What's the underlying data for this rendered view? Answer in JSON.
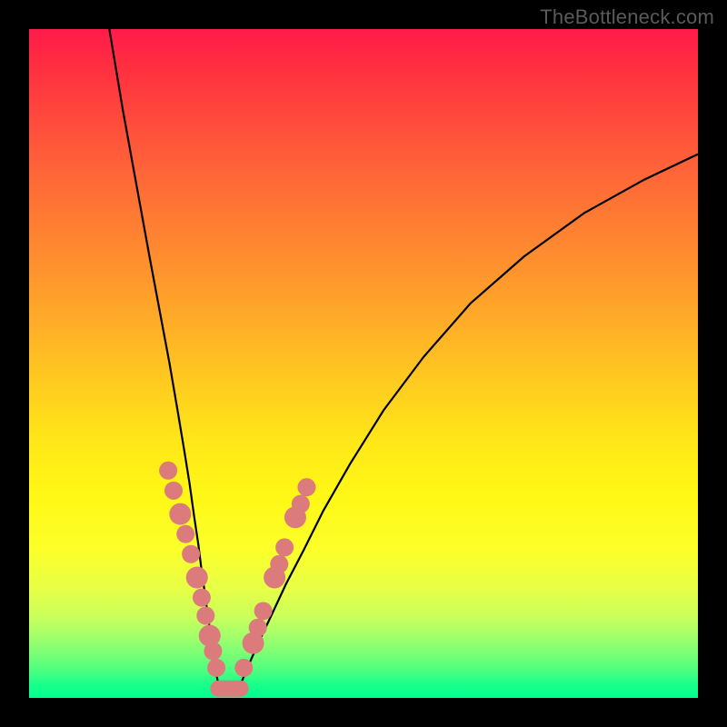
{
  "watermark": "TheBottleneck.com",
  "chart_data": {
    "type": "line",
    "title": "",
    "xlabel": "",
    "ylabel": "",
    "xlim": [
      0,
      100
    ],
    "ylim": [
      0,
      100
    ],
    "series": [
      {
        "name": "left-curve",
        "x": [
          12,
          14,
          16,
          18,
          19.5,
          21,
          22.2,
          23.2,
          24,
          24.7,
          25.3,
          25.8,
          26.3,
          26.7,
          27.1,
          27.4,
          27.7,
          28,
          28.3
        ],
        "values": [
          100,
          88,
          77,
          66,
          58,
          50,
          43,
          37,
          32,
          27,
          23,
          19,
          15.5,
          12.5,
          9.8,
          7.5,
          5.5,
          3.6,
          2
        ]
      },
      {
        "name": "right-curve",
        "x": [
          31.6,
          33,
          34.5,
          36.3,
          38.4,
          41,
          44,
          48,
          53,
          59,
          66,
          74,
          83,
          92,
          100
        ],
        "values": [
          2,
          5.3,
          8.7,
          12.5,
          17,
          22,
          28,
          35,
          43,
          51,
          59,
          66,
          72.5,
          77.5,
          81.3
        ]
      }
    ],
    "markers": {
      "left": [
        {
          "x": 20.8,
          "y": 34,
          "r": 10
        },
        {
          "x": 21.6,
          "y": 31,
          "r": 10
        },
        {
          "x": 22.6,
          "y": 27.5,
          "r": 12
        },
        {
          "x": 23.4,
          "y": 24.5,
          "r": 10
        },
        {
          "x": 24.2,
          "y": 21.5,
          "r": 10
        },
        {
          "x": 25.1,
          "y": 18,
          "r": 12
        },
        {
          "x": 25.8,
          "y": 15,
          "r": 10
        },
        {
          "x": 26.4,
          "y": 12.3,
          "r": 10
        },
        {
          "x": 27.0,
          "y": 9.3,
          "r": 12
        },
        {
          "x": 27.5,
          "y": 7,
          "r": 10
        },
        {
          "x": 28.0,
          "y": 4.5,
          "r": 10
        }
      ],
      "right": [
        {
          "x": 32.1,
          "y": 4.5,
          "r": 10
        },
        {
          "x": 33.5,
          "y": 8.2,
          "r": 12
        },
        {
          "x": 34.2,
          "y": 10.5,
          "r": 10
        },
        {
          "x": 35.0,
          "y": 13,
          "r": 10
        },
        {
          "x": 36.7,
          "y": 18,
          "r": 12
        },
        {
          "x": 37.4,
          "y": 20,
          "r": 10
        },
        {
          "x": 38.2,
          "y": 22.5,
          "r": 10
        },
        {
          "x": 39.8,
          "y": 27,
          "r": 12
        },
        {
          "x": 40.6,
          "y": 29,
          "r": 10
        },
        {
          "x": 41.5,
          "y": 31.5,
          "r": 10
        }
      ],
      "bottom_pill": {
        "x0": 28.3,
        "x1": 31.6,
        "y": 1.4,
        "r": 9
      }
    }
  }
}
